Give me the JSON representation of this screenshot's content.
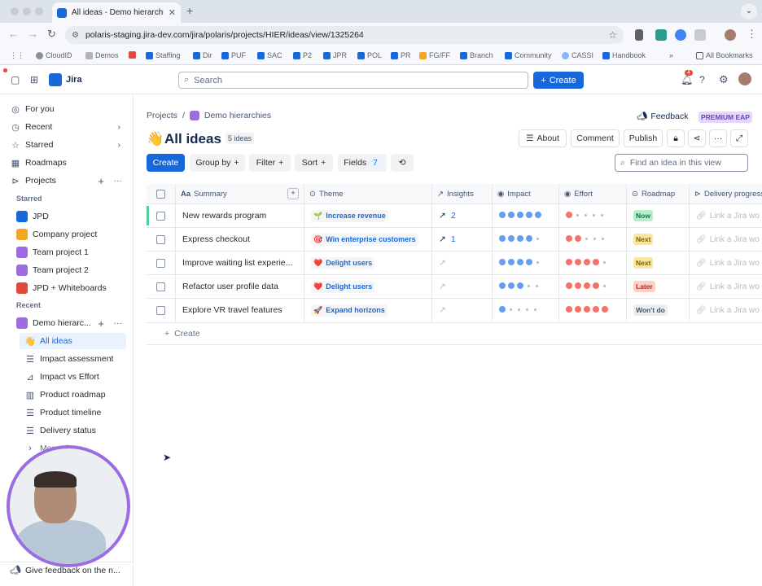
{
  "browser": {
    "tab_title": "All ideas - Demo hierarchies",
    "url": "polaris-staging.jira-dev.com/jira/polaris/projects/HIER/ideas/view/1325264",
    "bookmarks": [
      "CloudID",
      "Demos",
      "Staffing",
      "Dir",
      "PUF",
      "SAC",
      "P2",
      "JPR",
      "POL",
      "PR",
      "FG/FF",
      "Branch",
      "Community",
      "CASSI",
      "Handbook"
    ],
    "all_bookmarks": "All Bookmarks",
    "more": "»"
  },
  "topnav": {
    "app_name": "Jira",
    "search_placeholder": "Search",
    "create_label": "Create",
    "notif_count": "4"
  },
  "sidebar": {
    "items": [
      {
        "label": "For you",
        "icon": "person-icon"
      },
      {
        "label": "Recent",
        "icon": "clock-icon"
      },
      {
        "label": "Starred",
        "icon": "star-icon"
      },
      {
        "label": "Roadmaps",
        "icon": "roadmap-icon"
      },
      {
        "label": "Projects",
        "icon": "projects-icon"
      }
    ],
    "starred_header": "Starred",
    "starred": [
      {
        "label": "JPD",
        "color": "#1868db"
      },
      {
        "label": "Company project",
        "color": "#f5a623"
      },
      {
        "label": "Team project 1",
        "color": "#9b6de1"
      },
      {
        "label": "Team project 2",
        "color": "#9b6de1"
      },
      {
        "label": "JPD + Whiteboards",
        "color": "#e2483d"
      }
    ],
    "recent_header": "Recent",
    "recent_project": "Demo hierarc...",
    "views": [
      {
        "label": "All ideas",
        "selected": true
      },
      {
        "label": "Impact assessment"
      },
      {
        "label": "Impact vs Effort"
      },
      {
        "label": "Product roadmap"
      },
      {
        "label": "Product timeline"
      },
      {
        "label": "Delivery status"
      }
    ],
    "more_views": "More views",
    "feedback": "Give feedback on the n..."
  },
  "main": {
    "breadcrumb": {
      "root": "Projects",
      "project": "Demo hierarchies"
    },
    "feedback_label": "Feedback",
    "premium_badge": "PREMIUM EAP",
    "title_emoji": "👋",
    "title": "All ideas",
    "count_badge": "5 ideas",
    "actions": {
      "about": "About",
      "comment": "Comment",
      "publish": "Publish"
    },
    "toolbar": {
      "create": "Create",
      "group_by": "Group by",
      "filter": "Filter",
      "sort": "Sort",
      "fields": "Fields",
      "fields_count": "7"
    },
    "find_placeholder": "Find an idea in this view",
    "columns": [
      "Summary",
      "Theme",
      "Insights",
      "Impact",
      "Effort",
      "Roadmap",
      "Delivery progress"
    ],
    "rows": [
      {
        "summary": "New rewards program",
        "theme": "Increase revenue",
        "theme_emoji": "🌱",
        "insights": "2",
        "impact": 5,
        "effort": 1,
        "roadmap": "Now",
        "roadmap_bg": "#b3f0c8",
        "roadmap_fg": "#216e4e",
        "delivery": "Link a Jira wo"
      },
      {
        "summary": "Express checkout",
        "theme": "Win enterprise customers",
        "theme_emoji": "🎯",
        "insights": "1",
        "impact": 4,
        "effort": 2,
        "roadmap": "Next",
        "roadmap_bg": "#f8e6a0",
        "roadmap_fg": "#7f5f01",
        "delivery": "Link a Jira wo"
      },
      {
        "summary": "Improve waiting list experie...",
        "theme": "Delight users",
        "theme_emoji": "❤️",
        "insights": "",
        "impact": 4,
        "effort": 4,
        "roadmap": "Next",
        "roadmap_bg": "#f8e6a0",
        "roadmap_fg": "#7f5f01",
        "delivery": "Link a Jira wo"
      },
      {
        "summary": "Refactor user profile data",
        "theme": "Delight users",
        "theme_emoji": "❤️",
        "insights": "",
        "impact": 3,
        "effort": 4,
        "roadmap": "Later",
        "roadmap_bg": "#fdd0cb",
        "roadmap_fg": "#ae2e24",
        "delivery": "Link a Jira wo"
      },
      {
        "summary": "Explore VR travel features",
        "theme": "Expand horizons",
        "theme_emoji": "🚀",
        "insights": "",
        "impact": 1,
        "effort": 5,
        "roadmap": "Won't do",
        "roadmap_bg": "#ebecf0",
        "roadmap_fg": "#44546f",
        "delivery": "Link a Jira wo"
      }
    ],
    "add_row": "Create"
  },
  "colors": {
    "impact_dot": "#669df1",
    "effort_dot": "#f87168",
    "accent": "#1868db"
  }
}
